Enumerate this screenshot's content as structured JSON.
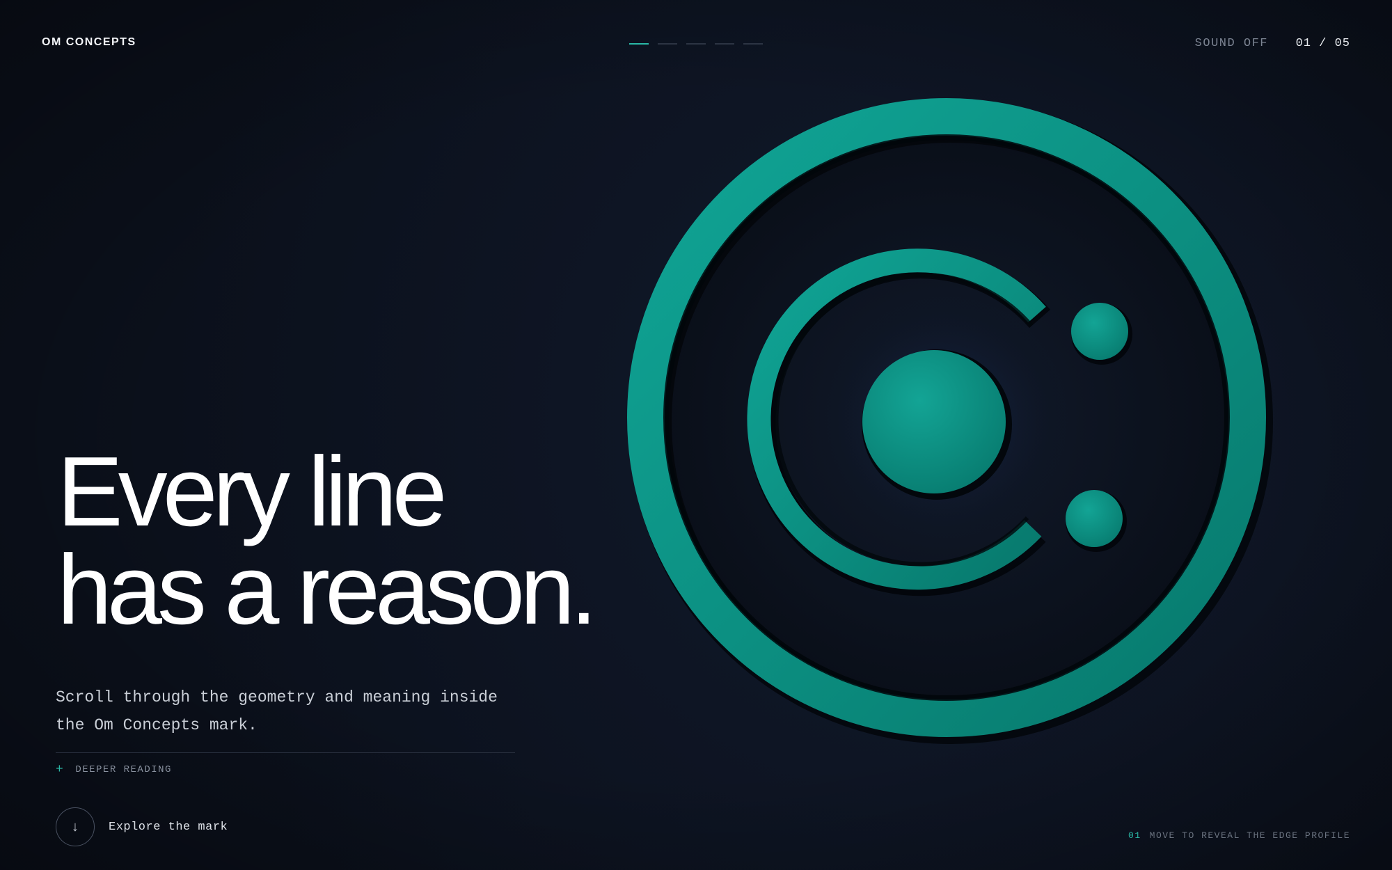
{
  "header": {
    "brand": "OM CONCEPTS",
    "progress": {
      "total": 5,
      "current": 1
    },
    "sound_label": "SOUND OFF",
    "counter": "01 / 05"
  },
  "hero": {
    "headline_line1": "Every line",
    "headline_line2": "has a reason.",
    "subtitle": "Scroll through the geometry and meaning inside the Om Concepts mark.",
    "deeper_label": "DEEPER READING",
    "explore_label": "Explore the mark"
  },
  "footer_hint": {
    "number": "01",
    "text": "MOVE TO REVEAL THE EDGE PROFILE"
  },
  "icons": {
    "plus": "+",
    "arrow_down": "↓"
  },
  "colors": {
    "background": "#0b101b",
    "accent": "#2ab8a6",
    "mark_green": "#0e9284"
  }
}
